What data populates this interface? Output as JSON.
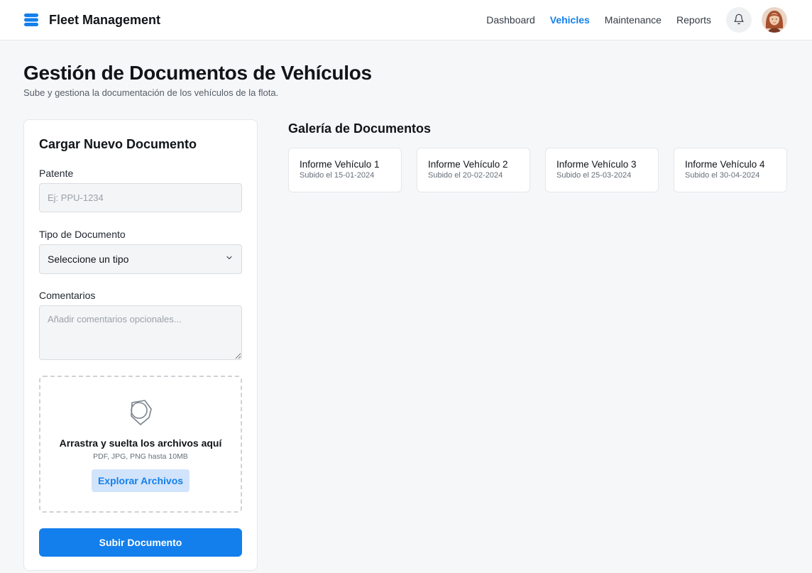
{
  "header": {
    "title": "Fleet Management",
    "nav": [
      {
        "label": "Dashboard",
        "active": false
      },
      {
        "label": "Vehicles",
        "active": true
      },
      {
        "label": "Maintenance",
        "active": false
      },
      {
        "label": "Reports",
        "active": false
      }
    ],
    "accent_color": "#137fec",
    "icons": [
      "stack-logo-icon",
      "bell-icon",
      "user-avatar"
    ]
  },
  "page": {
    "title": "Gestión de Documentos de Vehículos",
    "subtitle": "Sube y gestiona la documentación de los vehículos de la flota."
  },
  "upload_form": {
    "title": "Cargar Nuevo Documento",
    "patente_label": "Patente",
    "patente_placeholder": "Ej: PPU-1234",
    "patente_value": "",
    "tipo_label": "Tipo de Documento",
    "tipo_selected": "Seleccione un tipo",
    "comentarios_label": "Comentarios",
    "comentarios_placeholder": "Añadir comentarios opcionales...",
    "comentarios_value": "",
    "dropzone_title": "Arrastra y suelta los archivos aquí",
    "dropzone_hint": "PDF, JPG, PNG hasta 10MB",
    "browse_label": "Explorar Archivos",
    "submit_label": "Subir Documento"
  },
  "gallery": {
    "title": "Galería de Documentos",
    "documents": [
      {
        "name": "Informe Vehículo 1",
        "date": "Subido el 15-01-2024"
      },
      {
        "name": "Informe Vehículo 2",
        "date": "Subido el 20-02-2024"
      },
      {
        "name": "Informe Vehículo 3",
        "date": "Subido el 25-03-2024"
      },
      {
        "name": "Informe Vehículo 4",
        "date": "Subido el 30-04-2024"
      }
    ]
  }
}
